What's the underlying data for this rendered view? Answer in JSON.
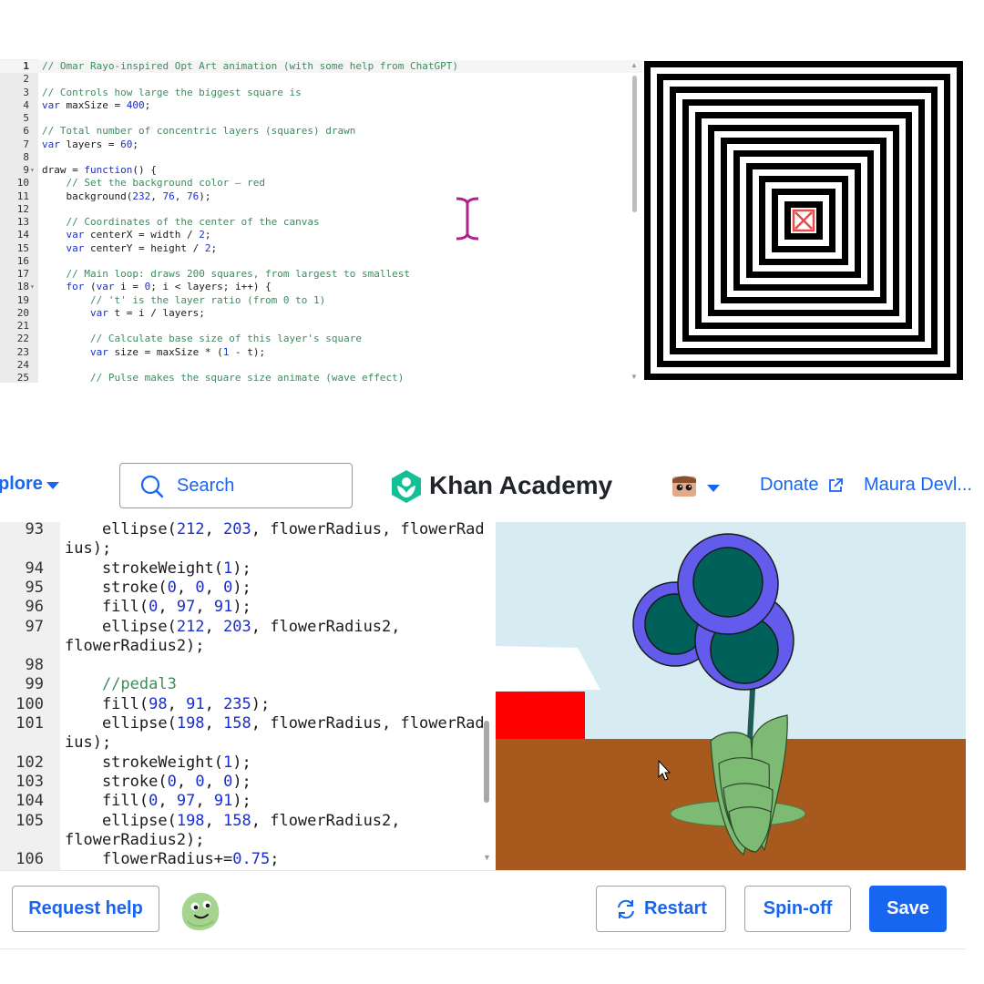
{
  "top_editor": {
    "lines": [
      {
        "n": "1",
        "code": "// Omar Rayo-inspired Opt Art animation (with some help from ChatGPT)"
      },
      {
        "n": "2",
        "code": ""
      },
      {
        "n": "3",
        "code": "// Controls how large the biggest square is"
      },
      {
        "n": "4",
        "code": "var maxSize = 400;"
      },
      {
        "n": "5",
        "code": ""
      },
      {
        "n": "6",
        "code": "// Total number of concentric layers (squares) drawn"
      },
      {
        "n": "7",
        "code": "var layers = 60;"
      },
      {
        "n": "8",
        "code": ""
      },
      {
        "n": "9",
        "code": "draw = function() {"
      },
      {
        "n": "10",
        "code": "    // Set the background color — red"
      },
      {
        "n": "11",
        "code": "    background(232, 76, 76);"
      },
      {
        "n": "12",
        "code": ""
      },
      {
        "n": "13",
        "code": "    // Coordinates of the center of the canvas"
      },
      {
        "n": "14",
        "code": "    var centerX = width / 2;"
      },
      {
        "n": "15",
        "code": "    var centerY = height / 2;"
      },
      {
        "n": "16",
        "code": ""
      },
      {
        "n": "17",
        "code": "    // Main loop: draws 200 squares, from largest to smallest"
      },
      {
        "n": "18",
        "code": "    for (var i = 0; i < layers; i++) {"
      },
      {
        "n": "19",
        "code": "        // 't' is the layer ratio (from 0 to 1)"
      },
      {
        "n": "20",
        "code": "        var t = i / layers;"
      },
      {
        "n": "21",
        "code": ""
      },
      {
        "n": "22",
        "code": "        // Calculate base size of this layer's square"
      },
      {
        "n": "23",
        "code": "        var size = maxSize * (1 - t);"
      },
      {
        "n": "24",
        "code": ""
      },
      {
        "n": "25",
        "code": "        // Pulse makes the square size animate (wave effect)"
      }
    ]
  },
  "header": {
    "explore_label": "plore",
    "search_label": "Search",
    "logo_text": "Khan Academy",
    "donate_label": "Donate",
    "user_name": "Maura Devl..."
  },
  "bottom_editor": {
    "lines": [
      {
        "n": "93",
        "code": "    ellipse(212, 203, flowerRadius, flowerRad"
      },
      {
        "n": "",
        "code": "ius);"
      },
      {
        "n": "94",
        "code": "    strokeWeight(1);"
      },
      {
        "n": "95",
        "code": "    stroke(0, 0, 0);"
      },
      {
        "n": "96",
        "code": "    fill(0, 97, 91);"
      },
      {
        "n": "97",
        "code": "    ellipse(212, 203, flowerRadius2,"
      },
      {
        "n": "",
        "code": "flowerRadius2);"
      },
      {
        "n": "98",
        "code": ""
      },
      {
        "n": "99",
        "code": "    //pedal3"
      },
      {
        "n": "100",
        "code": "    fill(98, 91, 235);"
      },
      {
        "n": "101",
        "code": "    ellipse(198, 158, flowerRadius, flowerRad"
      },
      {
        "n": "",
        "code": "ius);"
      },
      {
        "n": "102",
        "code": "    strokeWeight(1);"
      },
      {
        "n": "103",
        "code": "    stroke(0, 0, 0);"
      },
      {
        "n": "104",
        "code": "    fill(0, 97, 91);"
      },
      {
        "n": "105",
        "code": "    ellipse(198, 158, flowerRadius2,"
      },
      {
        "n": "",
        "code": "flowerRadius2);"
      },
      {
        "n": "106",
        "code": "    flowerRadius+=0.75;"
      }
    ]
  },
  "footer": {
    "request_help_label": "Request help",
    "restart_label": "Restart",
    "spinoff_label": "Spin-off",
    "save_label": "Save"
  },
  "colors": {
    "ka_blue": "#1865f2",
    "ka_green": "#14bf96",
    "sky": "#d6ebf2",
    "ground": "#a85a1e",
    "petal": "#625beb",
    "petal_center": "#00615b",
    "leaf": "#7dba74",
    "barn_red": "#ff0000",
    "opart_red": "#e84c4c"
  }
}
